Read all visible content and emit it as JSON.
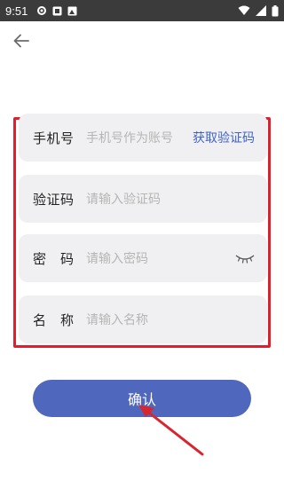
{
  "status_bar": {
    "time": "9:51"
  },
  "form": {
    "phone": {
      "label": "手机号",
      "placeholder": "手机号作为账号",
      "action": "获取验证码"
    },
    "code": {
      "label": "验证码",
      "placeholder": "请输入验证码"
    },
    "password": {
      "label": "密　码",
      "placeholder": "请输入密码"
    },
    "name": {
      "label": "名　称",
      "placeholder": "请输入名称"
    }
  },
  "confirm_button": {
    "label": "确认"
  },
  "colors": {
    "accent": "#4f67bd",
    "highlight": "#e01f2e",
    "field_bg": "#f0f0f2"
  }
}
